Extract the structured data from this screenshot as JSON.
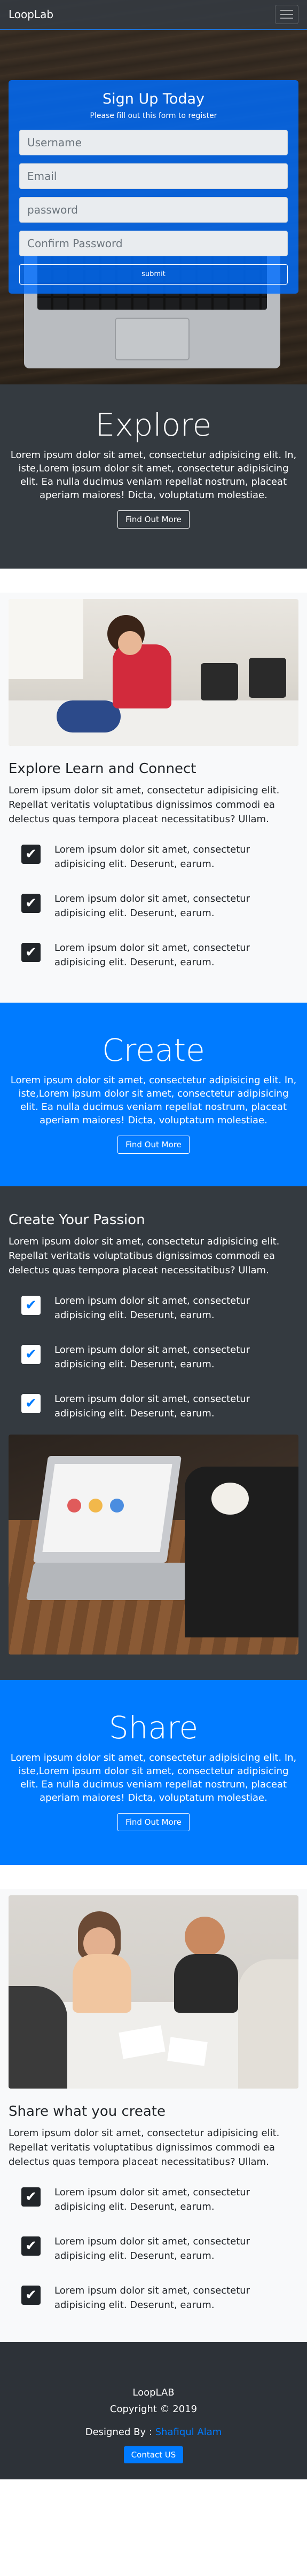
{
  "nav": {
    "brand": "LoopLab"
  },
  "signup": {
    "title": "Sign Up Today",
    "subtitle": "Please fill out this form to register",
    "fields": [
      "Username",
      "Email",
      "password",
      "Confirm Password"
    ],
    "submit_label": "submit"
  },
  "explore": {
    "title": "Explore",
    "body": "Lorem ipsum dolor sit amet, consectetur adipisicing elit. In, iste,Lorem ipsum dolor sit amet, consectetur adipisicing elit. Ea nulla ducimus veniam repellat nostrum, placeat aperiam maiores! Dicta, voluptatum molestiae.",
    "button": "Find Out More"
  },
  "learn": {
    "heading": "Explore Learn and Connect",
    "body": "Lorem ipsum dolor sit amet, consectetur adipisicing elit. Repellat veritatis voluptatibus dignissimos commodi ea delectus quas tempora placeat necessitatibus? Ullam.",
    "items": [
      "Lorem ipsum dolor sit amet, consectetur adipisicing elit. Deserunt, earum.",
      "Lorem ipsum dolor sit amet, consectetur adipisicing elit. Deserunt, earum.",
      "Lorem ipsum dolor sit amet, consectetur adipisicing elit. Deserunt, earum."
    ]
  },
  "create": {
    "title": "Create",
    "body": "Lorem ipsum dolor sit amet, consectetur adipisicing elit. In, iste,Lorem ipsum dolor sit amet, consectetur adipisicing elit. Ea nulla ducimus veniam repellat nostrum, placeat aperiam maiores! Dicta, voluptatum molestiae.",
    "button": "Find Out More"
  },
  "passion": {
    "heading": "Create Your Passion",
    "body": "Lorem ipsum dolor sit amet, consectetur adipisicing elit. Repellat veritatis voluptatibus dignissimos commodi ea delectus quas tempora placeat necessitatibus? Ullam.",
    "items": [
      "Lorem ipsum dolor sit amet, consectetur adipisicing elit. Deserunt, earum.",
      "Lorem ipsum dolor sit amet, consectetur adipisicing elit. Deserunt, earum.",
      "Lorem ipsum dolor sit amet, consectetur adipisicing elit. Deserunt, earum."
    ]
  },
  "share": {
    "title": "Share",
    "body": "Lorem ipsum dolor sit amet, consectetur adipisicing elit. In, iste,Lorem ipsum dolor sit amet, consectetur adipisicing elit. Ea nulla ducimus veniam repellat nostrum, placeat aperiam maiores! Dicta, voluptatum molestiae.",
    "button": "Find Out More"
  },
  "sharecreate": {
    "heading": "Share what you create",
    "body": "Lorem ipsum dolor sit amet, consectetur adipisicing elit. Repellat veritatis voluptatibus dignissimos commodi ea delectus quas tempora placeat necessitatibus? Ullam.",
    "items": [
      "Lorem ipsum dolor sit amet, consectetur adipisicing elit. Deserunt, earum.",
      "Lorem ipsum dolor sit amet, consectetur adipisicing elit. Deserunt, earum.",
      "Lorem ipsum dolor sit amet, consectetur adipisicing elit. Deserunt, earum."
    ]
  },
  "footer": {
    "title": "LoopLAB",
    "copyright": "Copyright © 2019",
    "designed_prefix": "Designed By : ",
    "designer": "Shafiqul Alam",
    "contact": "Contact US"
  },
  "colors": {
    "primary": "#007bff",
    "dark": "#343a40",
    "light": "#f8f9fa"
  },
  "icons": {
    "check": "check-icon",
    "menu": "hamburger-menu-icon"
  }
}
